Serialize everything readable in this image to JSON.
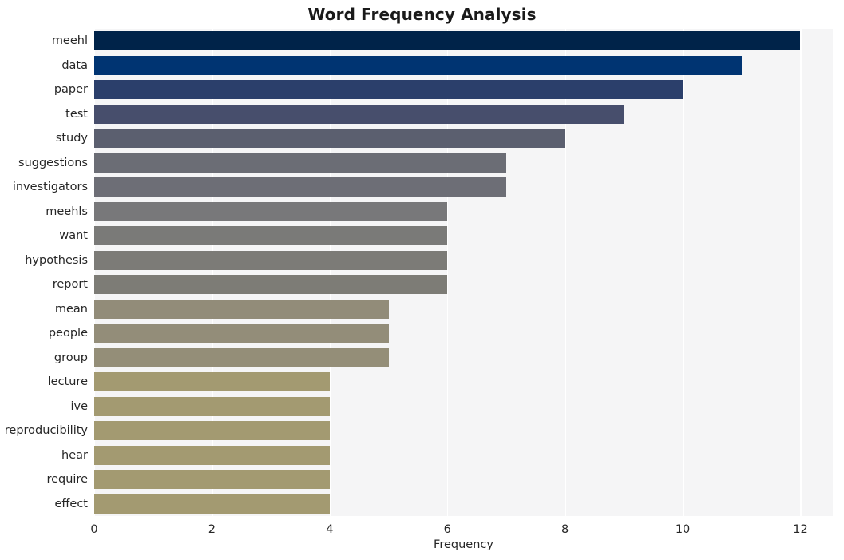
{
  "chart_data": {
    "type": "bar",
    "orientation": "horizontal",
    "title": "Word Frequency Analysis",
    "xlabel": "Frequency",
    "ylabel": "",
    "categories": [
      "meehl",
      "data",
      "paper",
      "test",
      "study",
      "suggestions",
      "investigators",
      "meehls",
      "want",
      "hypothesis",
      "report",
      "mean",
      "people",
      "group",
      "lecture",
      "ive",
      "reproducibility",
      "hear",
      "require",
      "effect"
    ],
    "values": [
      12,
      11,
      10,
      9,
      8,
      7,
      7,
      6,
      6,
      6,
      6,
      5,
      5,
      5,
      4,
      4,
      4,
      4,
      4,
      4
    ],
    "bar_colors": [
      "#002349",
      "#003472",
      "#2b3f6b",
      "#474e6c",
      "#5b5f6f",
      "#6b6d75",
      "#6d6e76",
      "#78787a",
      "#7a7a78",
      "#7c7b77",
      "#7d7c76",
      "#928c79",
      "#938d79",
      "#948e78",
      "#a39a71",
      "#a39a71",
      "#a39a71",
      "#a39a71",
      "#a39a71",
      "#a39a71"
    ],
    "xlim": [
      0,
      12.55
    ],
    "xticks": [
      0,
      2,
      4,
      6,
      8,
      10,
      12
    ],
    "xtick_labels": [
      "0",
      "2",
      "4",
      "6",
      "8",
      "10",
      "12"
    ],
    "grid": "vertical",
    "grid_color": "#ffffff",
    "plot_background": "#f5f5f6",
    "figure_background": "#ffffff",
    "legend": null,
    "colormap": "cividis"
  }
}
